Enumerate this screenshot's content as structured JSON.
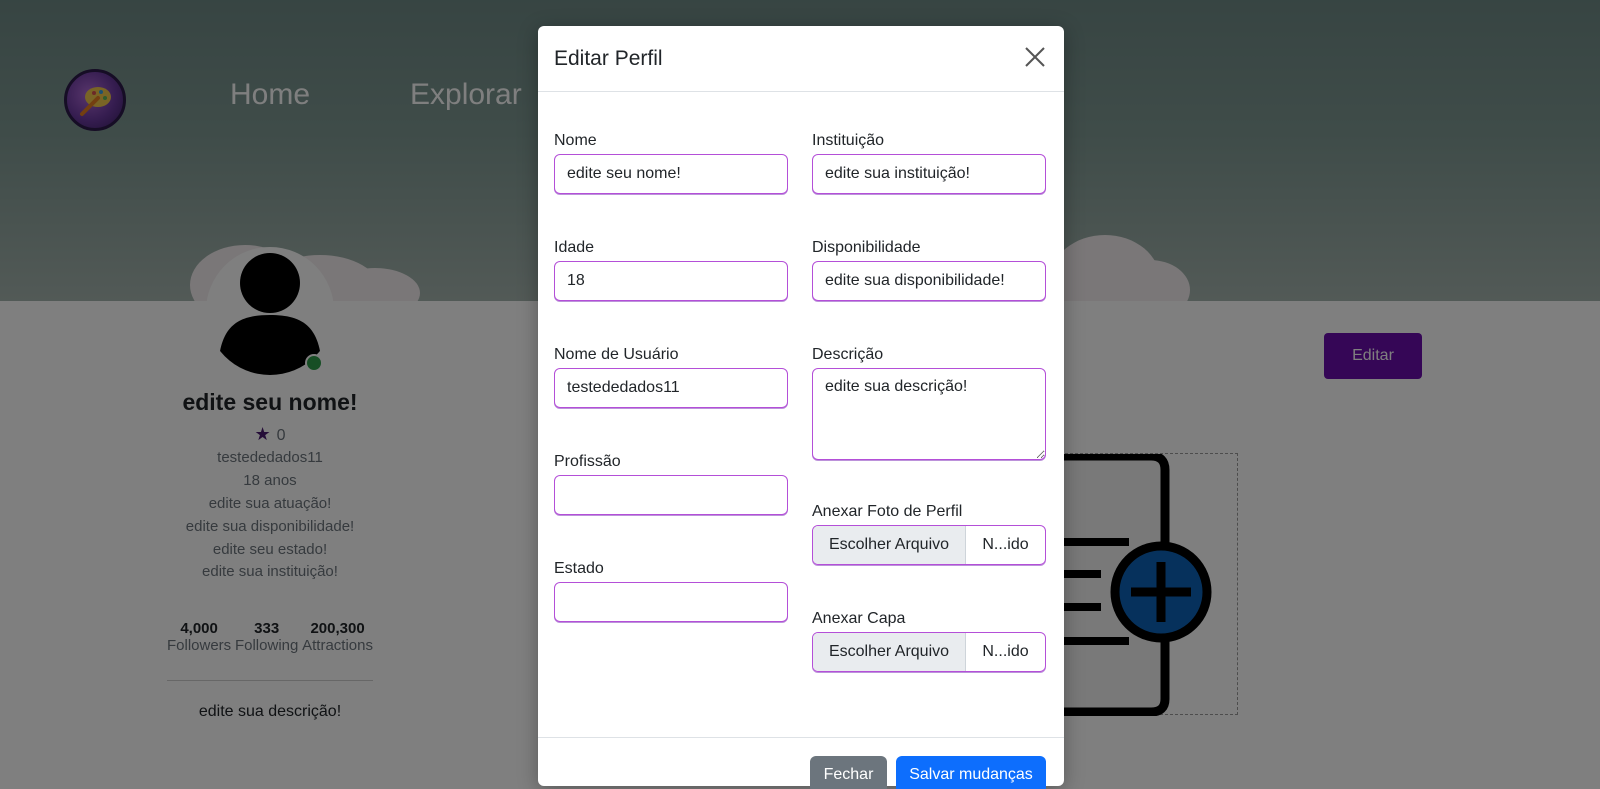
{
  "nav": {
    "home": "Home",
    "explore": "Explorar"
  },
  "profile": {
    "name": "edite seu nome!",
    "rating": "0",
    "username": "testededados11",
    "age": "18 anos",
    "occupation": "edite sua atuação!",
    "availability": "edite sua disponibilidade!",
    "state": "edite seu estado!",
    "institution": "edite sua instituição!",
    "description": "edite sua descrição!",
    "stats": [
      {
        "value": "4,000",
        "label": "Followers"
      },
      {
        "value": "333",
        "label": "Following"
      },
      {
        "value": "200,300",
        "label": "Attractions"
      }
    ],
    "edit_button": "Editar"
  },
  "modal": {
    "title": "Editar Perfil",
    "fields": {
      "name": {
        "label": "Nome",
        "value": "edite seu nome!"
      },
      "institution": {
        "label": "Instituição",
        "value": "edite sua instituição!"
      },
      "age": {
        "label": "Idade",
        "value": "18"
      },
      "availability": {
        "label": "Disponibilidade",
        "value": "edite sua disponibilidade!"
      },
      "username": {
        "label": "Nome de Usuário",
        "value": "testededados11"
      },
      "description": {
        "label": "Descrição",
        "value": "edite sua descrição!"
      },
      "profession": {
        "label": "Profissão",
        "value": ""
      },
      "state": {
        "label": "Estado",
        "value": ""
      },
      "profile_photo": {
        "label": "Anexar Foto de Perfil",
        "button": "Escolher Arquivo",
        "filename": "N...ido"
      },
      "cover": {
        "label": "Anexar Capa",
        "button": "Escolher Arquivo",
        "filename": "N...ido"
      }
    },
    "footer": {
      "close": "Fechar",
      "save": "Salvar mudanças"
    }
  },
  "colors": {
    "accent": "#6a0dad",
    "primary": "#0d6efd",
    "secondary": "#6c757d",
    "online": "#2e9c4a"
  }
}
